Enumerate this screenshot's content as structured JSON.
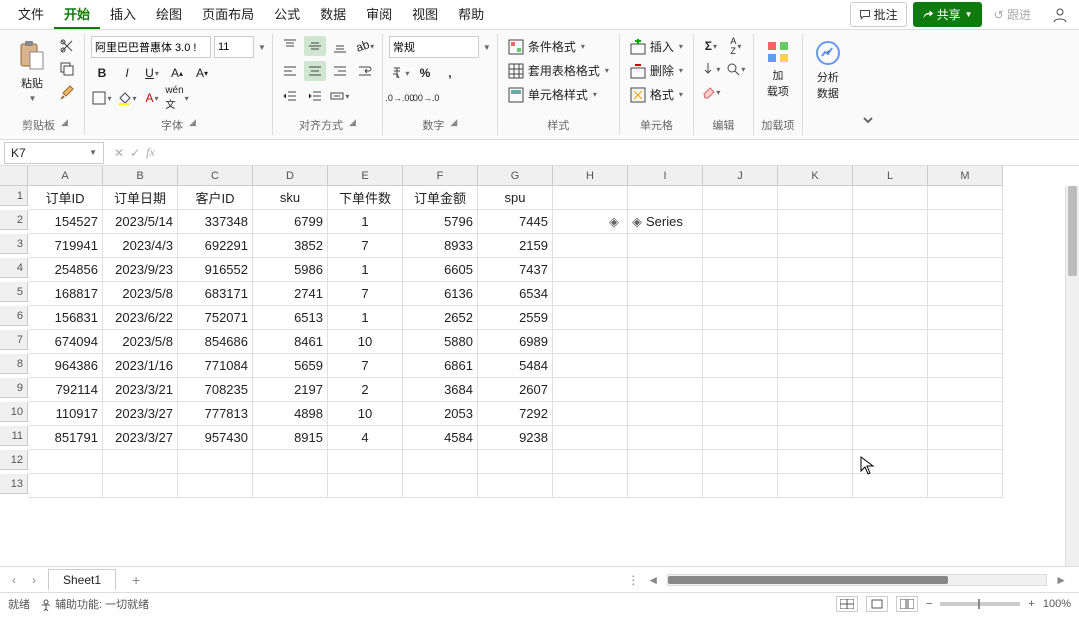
{
  "menu": {
    "items": [
      "文件",
      "开始",
      "插入",
      "绘图",
      "页面布局",
      "公式",
      "数据",
      "审阅",
      "视图",
      "帮助"
    ],
    "activeIndex": 1
  },
  "menubar_right": {
    "comments": "批注",
    "share": "共享",
    "history": "跟进"
  },
  "ribbon": {
    "clipboard": {
      "paste": "粘贴",
      "label": "剪贴板"
    },
    "font": {
      "name": "阿里巴巴普惠体 3.0 !",
      "size": "11",
      "label": "字体"
    },
    "alignment": {
      "label": "对齐方式"
    },
    "number": {
      "format": "常规",
      "label": "数字"
    },
    "styles": {
      "cond": "条件格式",
      "tablefmt": "套用表格格式",
      "cellstyle": "单元格样式",
      "label": "样式"
    },
    "cells": {
      "insert": "插入",
      "delete": "删除",
      "format": "格式",
      "label": "单元格"
    },
    "editing": {
      "label": "编辑"
    },
    "addins": {
      "addbtn": "加\n载项",
      "label": "加载项"
    },
    "analysis": {
      "btn": "分析\n数据"
    }
  },
  "namebox": "K7",
  "columns": [
    "A",
    "B",
    "C",
    "D",
    "E",
    "F",
    "G",
    "H",
    "I",
    "J",
    "K",
    "L",
    "M"
  ],
  "headers": [
    "订单ID",
    "订单日期",
    "客户ID",
    "sku",
    "下单件数",
    "订单金额",
    "spu"
  ],
  "rows": [
    [
      "154527",
      "2023/5/14",
      "337348",
      "6799",
      "1",
      "5796",
      "7445"
    ],
    [
      "719941",
      "2023/4/3",
      "692291",
      "3852",
      "7",
      "8933",
      "2159"
    ],
    [
      "254856",
      "2023/9/23",
      "916552",
      "5986",
      "1",
      "6605",
      "7437"
    ],
    [
      "168817",
      "2023/5/8",
      "683171",
      "2741",
      "7",
      "6136",
      "6534"
    ],
    [
      "156831",
      "2023/6/22",
      "752071",
      "6513",
      "1",
      "2652",
      "2559"
    ],
    [
      "674094",
      "2023/5/8",
      "854686",
      "8461",
      "10",
      "5880",
      "6989"
    ],
    [
      "964386",
      "2023/1/16",
      "771084",
      "5659",
      "7",
      "6861",
      "5484"
    ],
    [
      "792114",
      "2023/3/21",
      "708235",
      "2197",
      "2",
      "3684",
      "2607"
    ],
    [
      "110917",
      "2023/3/27",
      "777813",
      "4898",
      "10",
      "2053",
      "7292"
    ],
    [
      "851791",
      "2023/3/27",
      "957430",
      "8915",
      "4",
      "4584",
      "9238"
    ]
  ],
  "series_label": "Series",
  "sheet_tab": "Sheet1",
  "status": {
    "ready": "就绪",
    "a11y": "辅助功能: 一切就绪",
    "zoom": "100%"
  }
}
